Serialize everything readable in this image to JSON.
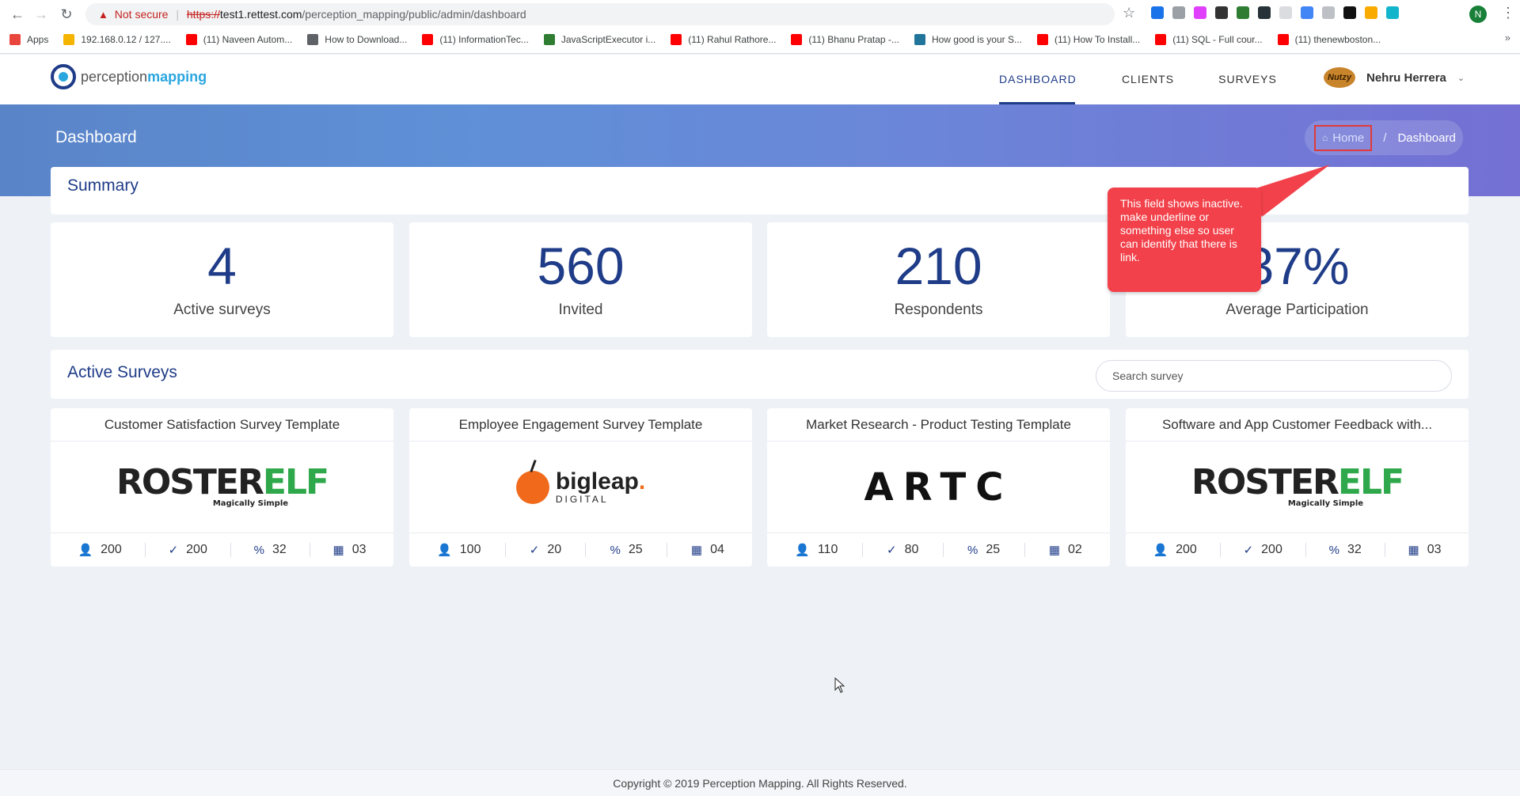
{
  "browser": {
    "not_secure": "Not secure",
    "url_proto": "https://",
    "url_host": "test1.rettest.com",
    "url_path": "/perception_mapping/public/admin/dashboard",
    "profile_initial": "N",
    "bookmarks": [
      {
        "label": "Apps",
        "color": "#e8453c"
      },
      {
        "label": "192.168.0.12 / 127....",
        "color": "#f4b400"
      },
      {
        "label": "(11) Naveen Autom...",
        "color": "#ff0000"
      },
      {
        "label": "How to Download...",
        "color": "#5f6368"
      },
      {
        "label": "(11) InformationTec...",
        "color": "#ff0000"
      },
      {
        "label": "JavaScriptExecutor i...",
        "color": "#2e7d32"
      },
      {
        "label": "(11) Rahul Rathore...",
        "color": "#ff0000"
      },
      {
        "label": "(11) Bhanu Pratap -...",
        "color": "#ff0000"
      },
      {
        "label": "How good is your S...",
        "color": "#21759b"
      },
      {
        "label": "(11) How To Install...",
        "color": "#ff0000"
      },
      {
        "label": "(11) SQL - Full cour...",
        "color": "#ff0000"
      },
      {
        "label": "(11) thenewboston...",
        "color": "#ff0000"
      }
    ],
    "bookmarks_more": "»"
  },
  "header": {
    "logo_part1": "perception",
    "logo_part2": "mapping",
    "nav": [
      "DASHBOARD",
      "CLIENTS",
      "SURVEYS"
    ],
    "avatar_text": "Nutzy",
    "user_name": "Nehru Herrera"
  },
  "banner": {
    "title": "Dashboard",
    "breadcrumb_home": "Home",
    "breadcrumb_sep": "/",
    "breadcrumb_current": "Dashboard"
  },
  "summary": {
    "title": "Summary",
    "stats": [
      {
        "value": "4",
        "label": "Active surveys"
      },
      {
        "value": "560",
        "label": "Invited"
      },
      {
        "value": "210",
        "label": "Respondents"
      },
      {
        "value": "37%",
        "label": "Average Participation"
      }
    ]
  },
  "active_surveys": {
    "title": "Active Surveys",
    "search_placeholder": "Search survey",
    "cards": [
      {
        "title": "Customer Satisfaction Survey Template",
        "logo": "rosterelf",
        "logo_a": "ROSTER",
        "logo_b": "ELF",
        "logo_c": "Magically Simple",
        "invited": "200",
        "responded": "200",
        "percent": "32",
        "days": "03"
      },
      {
        "title": "Employee Engagement Survey Template",
        "logo": "bigleap",
        "logo_a": "bigleap",
        "logo_b": ".",
        "logo_c": "DIGITAL",
        "invited": "100",
        "responded": "20",
        "percent": "25",
        "days": "04"
      },
      {
        "title": "Market Research - Product Testing Template",
        "logo": "artc",
        "logo_a": "ARTC",
        "invited": "110",
        "responded": "80",
        "percent": "25",
        "days": "02"
      },
      {
        "title": "Software and App Customer Feedback with...",
        "logo": "rosterelf",
        "logo_a": "ROSTER",
        "logo_b": "ELF",
        "logo_c": "Magically Simple",
        "invited": "200",
        "responded": "200",
        "percent": "32",
        "days": "03"
      }
    ]
  },
  "annotation": {
    "text": "This field shows inactive. make underline or something else so user can identify that there is link."
  },
  "footer": {
    "copyright": "Copyright © 2019 Perception Mapping. All Rights Reserved."
  }
}
